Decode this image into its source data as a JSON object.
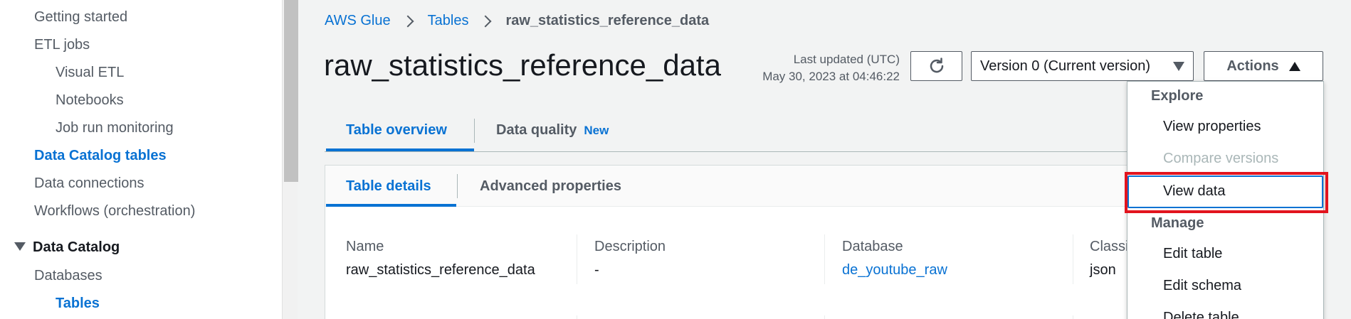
{
  "sidebar": {
    "items": [
      {
        "label": "Getting started"
      },
      {
        "label": "ETL jobs"
      },
      {
        "label": "Visual ETL"
      },
      {
        "label": "Notebooks"
      },
      {
        "label": "Job run monitoring"
      },
      {
        "label": "Data Catalog tables"
      },
      {
        "label": "Data connections"
      },
      {
        "label": "Workflows (orchestration)"
      },
      {
        "label": "Data Catalog"
      },
      {
        "label": "Databases"
      },
      {
        "label": "Tables"
      }
    ]
  },
  "breadcrumb": {
    "items": [
      "AWS Glue",
      "Tables",
      "raw_statistics_reference_data"
    ]
  },
  "header": {
    "title": "raw_statistics_reference_data",
    "last_updated_label": "Last updated (UTC)",
    "last_updated_value": "May 30, 2023 at 04:46:22",
    "version_label": "Version 0 (Current version)",
    "actions_label": "Actions"
  },
  "tabs": [
    {
      "label": "Table overview",
      "badge": ""
    },
    {
      "label": "Data quality",
      "badge": "New"
    }
  ],
  "subtabs": [
    {
      "label": "Table details"
    },
    {
      "label": "Advanced properties"
    }
  ],
  "details": {
    "name_label": "Name",
    "name_value": "raw_statistics_reference_data",
    "description_label": "Description",
    "description_value": "-",
    "database_label": "Database",
    "database_value": "de_youtube_raw",
    "classification_label": "Classification",
    "classification_value": "json"
  },
  "actions_menu": {
    "explore_label": "Explore",
    "view_properties": "View properties",
    "compare_versions": "Compare versions",
    "view_data": "View data",
    "manage_label": "Manage",
    "edit_table": "Edit table",
    "edit_schema": "Edit schema",
    "delete_table": "Delete table"
  },
  "colors": {
    "link": "#0972d3",
    "highlight": "#e2141e"
  }
}
